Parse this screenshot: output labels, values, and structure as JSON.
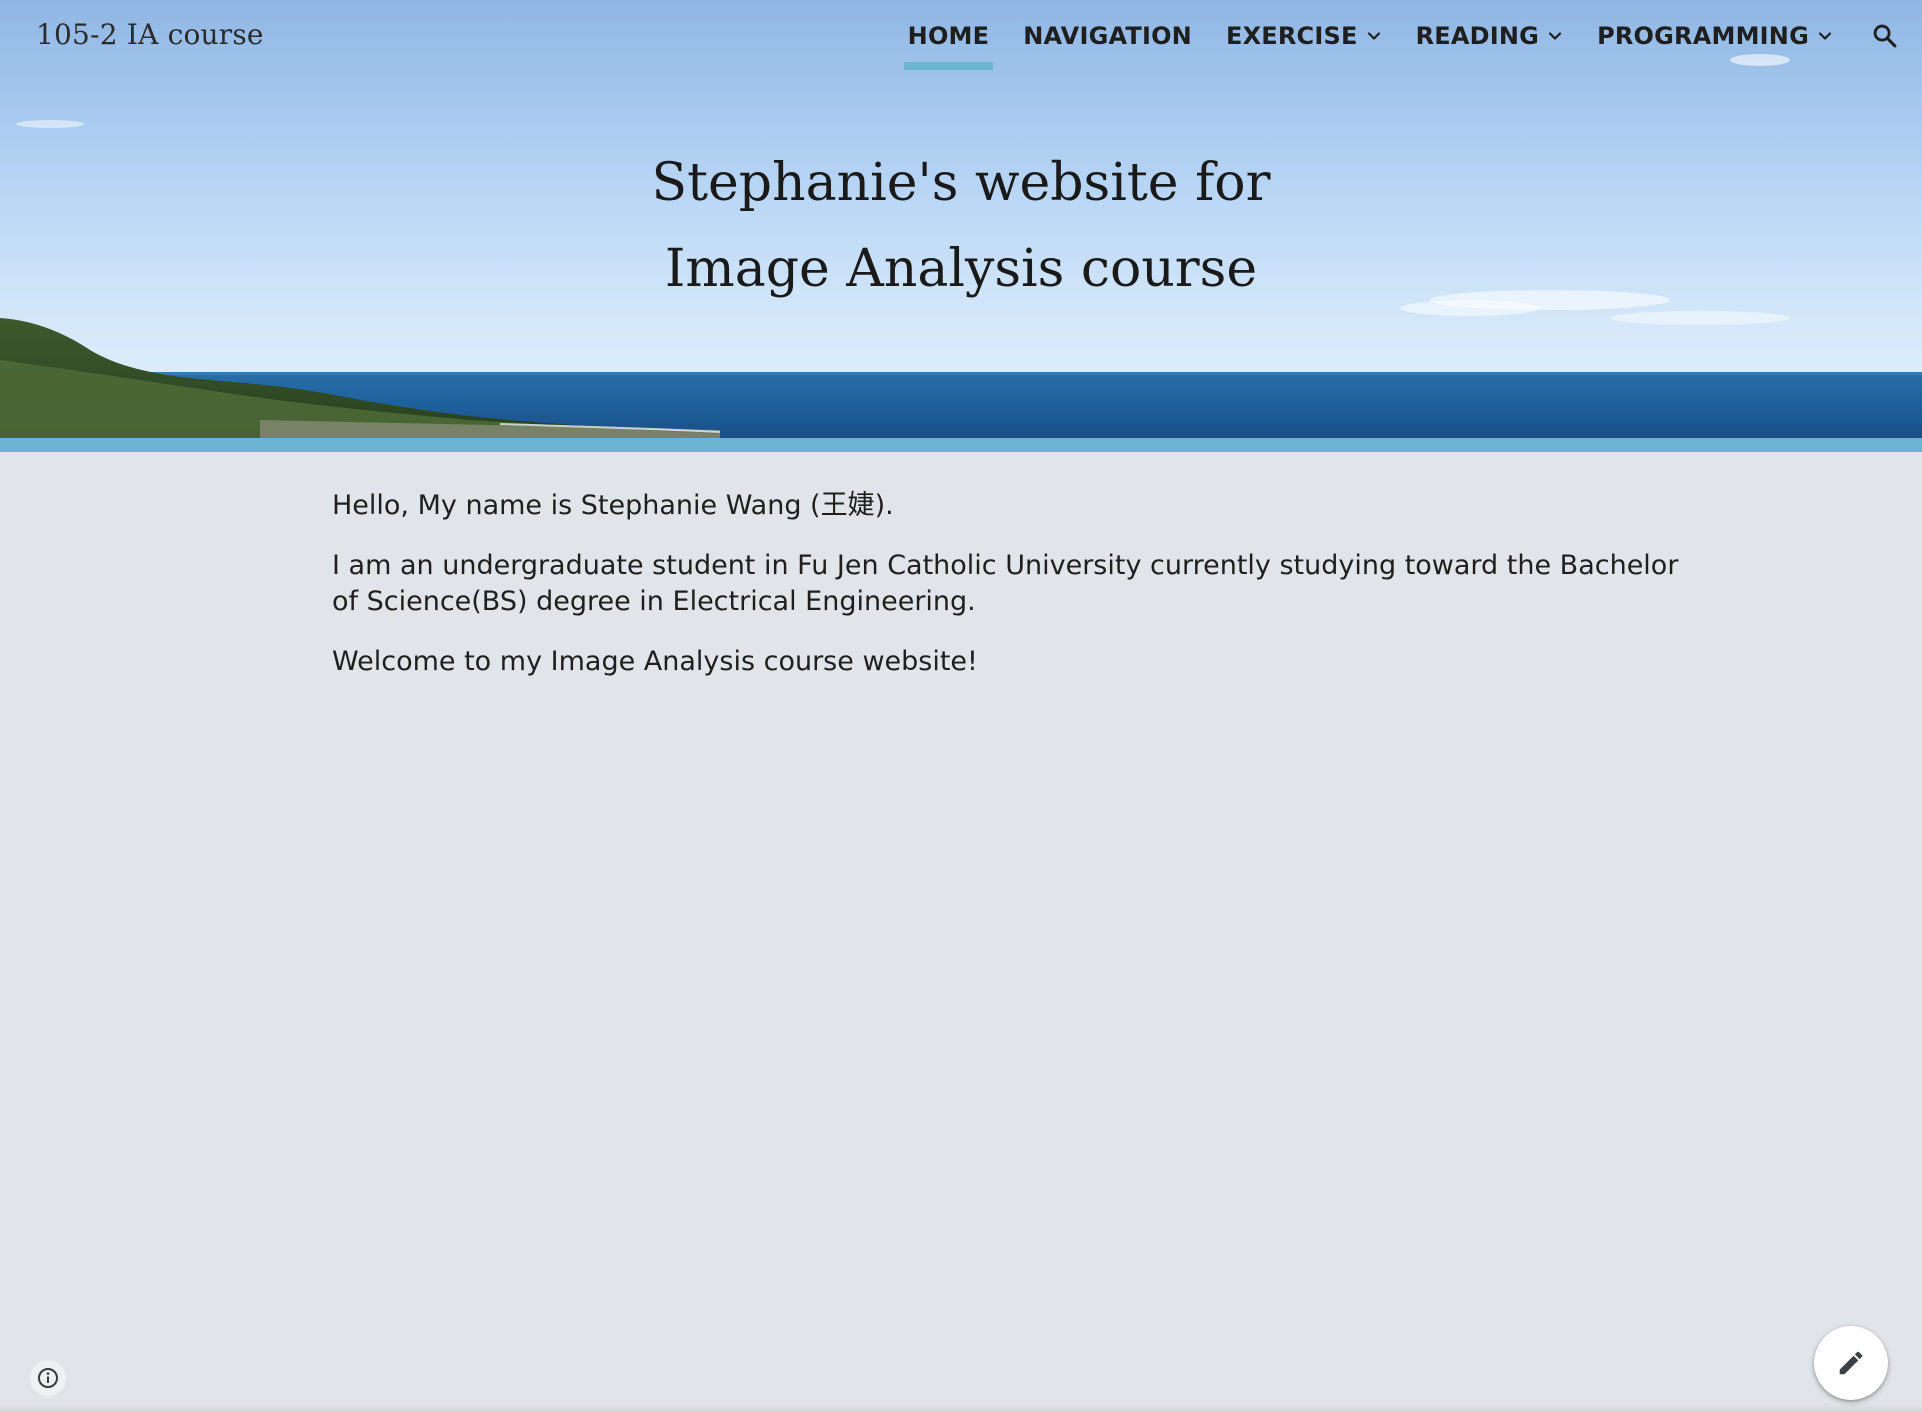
{
  "header": {
    "site_title": "105-2 IA course",
    "hero_title_line1": "Stephanie's website for",
    "hero_title_line2": "Image Analysis course"
  },
  "nav": {
    "items": [
      {
        "label": "HOME",
        "active": true,
        "has_dropdown": false
      },
      {
        "label": "NAVIGATION",
        "active": false,
        "has_dropdown": false
      },
      {
        "label": "EXERCISE",
        "active": false,
        "has_dropdown": true
      },
      {
        "label": "READING",
        "active": false,
        "has_dropdown": true
      },
      {
        "label": "PROGRAMMING",
        "active": false,
        "has_dropdown": true
      }
    ],
    "search_icon": "search-icon"
  },
  "content": {
    "paragraphs": [
      "Hello, My name is Stephanie Wang (王婕).",
      "I am an undergraduate student in Fu Jen Catholic University currently studying toward the Bachelor of Science(BS) degree in Electrical Engineering.",
      "Welcome to my Image Analysis course website!"
    ]
  },
  "footer": {
    "info_icon": "info-icon",
    "edit_icon": "pencil-icon"
  },
  "colors": {
    "accent": "#6db3d2",
    "page_background": "#e1e4e8",
    "text": "#1f1f1f"
  }
}
